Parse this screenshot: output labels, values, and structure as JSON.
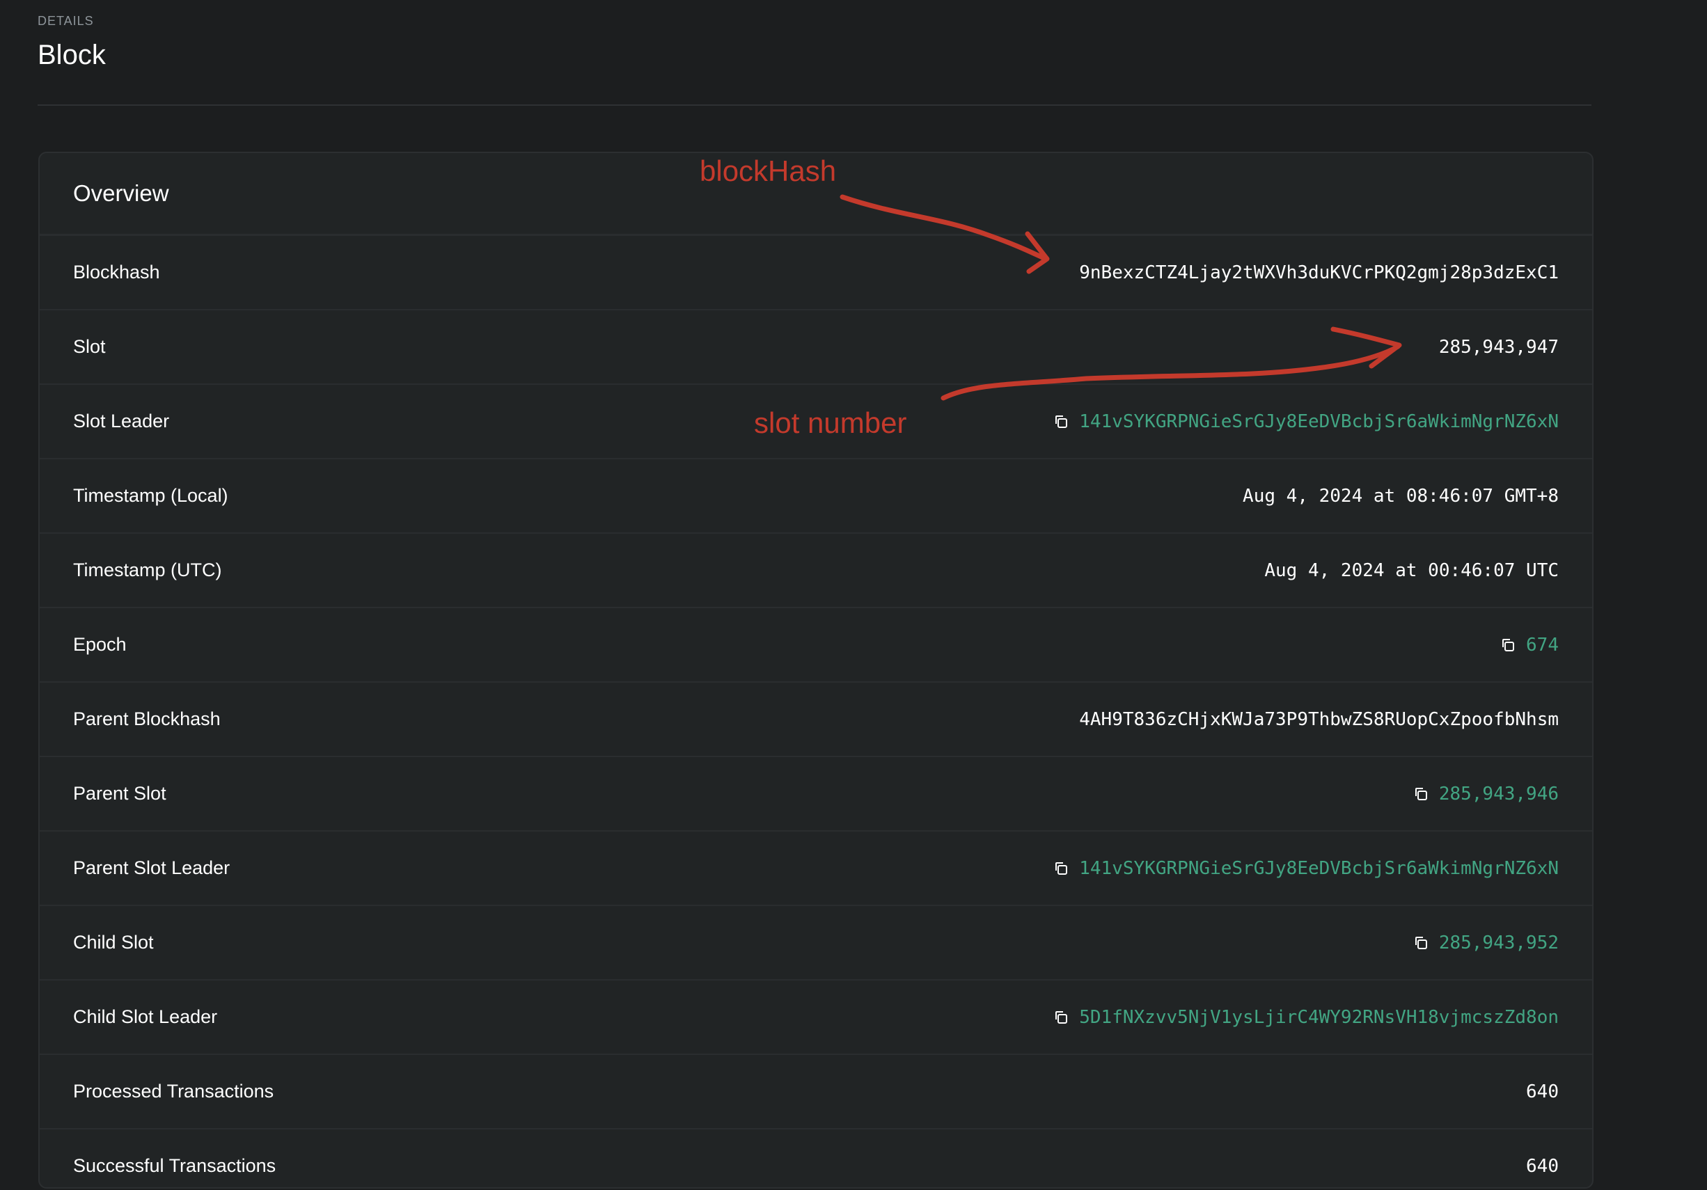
{
  "header": {
    "pretitle": "Details",
    "title": "Block"
  },
  "card": {
    "title": "Overview",
    "rows": [
      {
        "label": "Blockhash",
        "value": "9nBexzCTZ4Ljay2tWXVh3duKVCrPKQ2gmj28p3dzExC1",
        "link": false,
        "copy": false
      },
      {
        "label": "Slot",
        "value": "285,943,947",
        "link": false,
        "copy": false
      },
      {
        "label": "Slot Leader",
        "value": "141vSYKGRPNGieSrGJy8EeDVBcbjSr6aWkimNgrNZ6xN",
        "link": true,
        "copy": true
      },
      {
        "label": "Timestamp (Local)",
        "value": "Aug 4, 2024 at 08:46:07 GMT+8",
        "link": false,
        "copy": false
      },
      {
        "label": "Timestamp (UTC)",
        "value": "Aug 4, 2024 at 00:46:07 UTC",
        "link": false,
        "copy": false
      },
      {
        "label": "Epoch",
        "value": "674",
        "link": true,
        "copy": true
      },
      {
        "label": "Parent Blockhash",
        "value": "4AH9T836zCHjxKWJa73P9ThbwZS8RUopCxZpoofbNhsm",
        "link": false,
        "copy": false
      },
      {
        "label": "Parent Slot",
        "value": "285,943,946",
        "link": true,
        "copy": true
      },
      {
        "label": "Parent Slot Leader",
        "value": "141vSYKGRPNGieSrGJy8EeDVBcbjSr6aWkimNgrNZ6xN",
        "link": true,
        "copy": true
      },
      {
        "label": "Child Slot",
        "value": "285,943,952",
        "link": true,
        "copy": true
      },
      {
        "label": "Child Slot Leader",
        "value": "5D1fNXzvv5NjV1ysLjirC4WY92RNsVH18vjmcszZd8on",
        "link": true,
        "copy": true
      },
      {
        "label": "Processed Transactions",
        "value": "640",
        "link": false,
        "copy": false
      },
      {
        "label": "Successful Transactions",
        "value": "640",
        "link": false,
        "copy": false
      }
    ]
  },
  "annotations": {
    "blockhash_note": "blockHash",
    "slot_note": "slot number",
    "color": "#c43a2c"
  },
  "colors": {
    "background": "#1c1e1f",
    "card": "#212425",
    "link": "#42a583",
    "text": "#ffffff",
    "muted": "#8e959a"
  },
  "icons": {
    "copy": "copy-icon"
  }
}
